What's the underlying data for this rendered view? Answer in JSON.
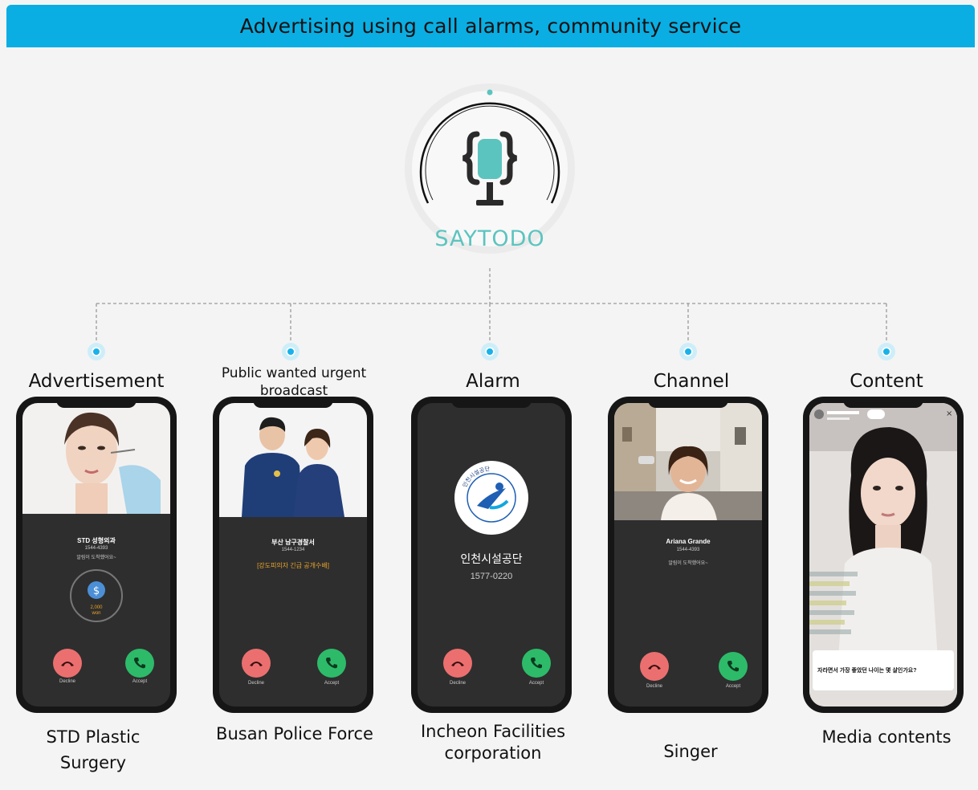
{
  "header": {
    "title": "Advertising using call alarms, community service"
  },
  "logo": {
    "name": "SAYTODO",
    "icon": "microphone-braces-icon",
    "accent": "#5cc4bf"
  },
  "colors": {
    "header_bg": "#0aaee3",
    "node": "#19b2e8",
    "decline": "#ec6f6f",
    "accept": "#2dbb6a"
  },
  "categories": [
    {
      "title": "Advertisement",
      "caption": "STD Plastic Surgery",
      "phone": {
        "caller": "STD 성형외과",
        "number": "1544-4393",
        "message": "알림이 도착했어요~",
        "reward_amount": "2,000",
        "reward_unit": "won",
        "decline": "Decline",
        "accept": "Accept"
      }
    },
    {
      "title": "Public wanted urgent broadcast",
      "caption": "Busan Police Force",
      "phone": {
        "caller": "부산 남구경찰서",
        "number": "1544-1234",
        "message": "[강도피의자 긴급 공개수배]",
        "decline": "Decline",
        "accept": "Accept"
      }
    },
    {
      "title": "Alarm",
      "caption": "Incheon Facilities corporation",
      "phone": {
        "caller": "인천시설공단",
        "number": "1577-0220",
        "seal_text": "인천시설공단",
        "decline": "Decline",
        "accept": "Accept"
      }
    },
    {
      "title": "Channel",
      "caption": "Singer",
      "phone": {
        "caller": "Ariana Grande",
        "number": "1544-4393",
        "message": "알림이 도착했어요~",
        "decline": "Decline",
        "accept": "Accept"
      }
    },
    {
      "title": "Content",
      "caption": "Media contents",
      "phone": {
        "question": "자라면서 가장 좋았던 나이는 몇 살인가요?"
      }
    }
  ]
}
